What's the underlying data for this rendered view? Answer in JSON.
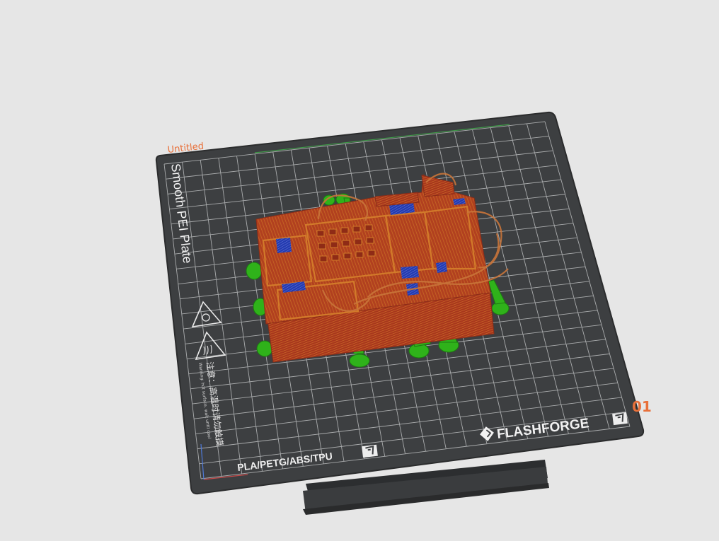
{
  "plate": {
    "project_name": "Untitled",
    "surface_name": "Smooth PEI Plate",
    "warning_cn": "注意：高温时请勿触摸",
    "warning_en": "Warning: hot surface, wait until cool",
    "materials": "PLA/PETG/ABS/TPU",
    "brand": "FLASHFORGE",
    "plate_index": "01"
  },
  "icons": [
    "bed-scan-icon",
    "hot-surface-warning-icon",
    "magnet-warning-icon",
    "flashforge-logo-icon"
  ],
  "colors": {
    "background": "#e6e6e6",
    "plate": "#3d3f41",
    "grid": "#c9cbcc",
    "model_wall": "#a9371f",
    "model_infill": "#c05a20",
    "bridge": "#2233aa",
    "support": "#2fb21a",
    "label_accent": "#e8703a"
  }
}
